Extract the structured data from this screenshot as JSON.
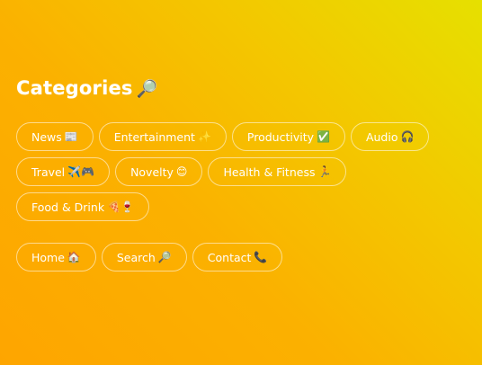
{
  "title": {
    "text": "Categories",
    "icon": "🔎",
    "icon_name": "magnifier-icon"
  },
  "categories": [
    {
      "label": "News",
      "emoji": "📰",
      "name": "category-news"
    },
    {
      "label": "Entertainment",
      "emoji": "✨",
      "name": "category-entertainment"
    },
    {
      "label": "Productivity",
      "emoji": "✅",
      "name": "category-productivity"
    },
    {
      "label": "Audio",
      "emoji": "🎧",
      "name": "category-audio"
    },
    {
      "label": "Travel",
      "emoji": "✈️🎮",
      "name": "category-travel"
    },
    {
      "label": "Novelty",
      "emoji": "😊",
      "name": "category-novelty"
    },
    {
      "label": "Health & Fitness",
      "emoji": "🏃",
      "name": "category-health-fitness"
    },
    {
      "label": "Food & Drink",
      "emoji": "🍕🍷",
      "name": "category-food-drink"
    }
  ],
  "nav": [
    {
      "label": "Home",
      "emoji": "🏠",
      "name": "nav-home"
    },
    {
      "label": "Search",
      "emoji": "🔎",
      "name": "nav-search"
    },
    {
      "label": "Contact",
      "emoji": "📞",
      "name": "nav-contact"
    }
  ],
  "colors": {
    "background_start": "#e6e000",
    "background_end": "#fea500",
    "text": "#ffffff"
  }
}
